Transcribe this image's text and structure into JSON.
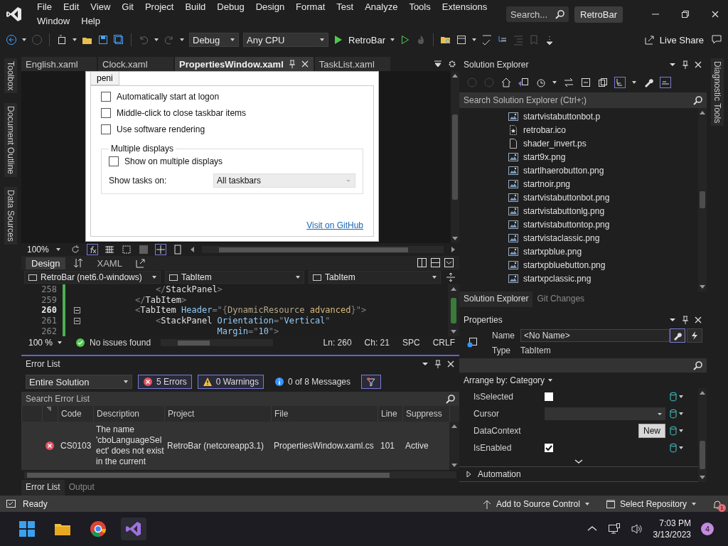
{
  "title_bar": {
    "menu": [
      "File",
      "Edit",
      "View",
      "Git",
      "Project",
      "Build",
      "Debug",
      "Design",
      "Format",
      "Test",
      "Analyze",
      "Tools",
      "Extensions",
      "Window",
      "Help"
    ],
    "search_placeholder": "Search...",
    "solution_name": "RetroBar"
  },
  "toolbar": {
    "configuration": "Debug",
    "platform": "Any CPU",
    "start_target": "RetroBar",
    "live_share": "Live Share"
  },
  "left_tool_tabs": [
    "Toolbox",
    "Document Outline",
    "Data Sources"
  ],
  "right_tool_tabs": [
    "Diagnostic Tools"
  ],
  "document_tabs": [
    {
      "label": "English.xaml",
      "selected": false
    },
    {
      "label": "Clock.xaml",
      "selected": false
    },
    {
      "label": "PropertiesWindow.xaml",
      "selected": true
    },
    {
      "label": "TaskList.xaml",
      "selected": false
    }
  ],
  "designer": {
    "tab_header": "peni",
    "checkboxes": [
      {
        "label": "Automatically start at logon",
        "checked": false
      },
      {
        "label": "Middle-click to close taskbar items",
        "checked": false
      },
      {
        "label": "Use software rendering",
        "checked": false
      }
    ],
    "group": {
      "title": "Multiple displays",
      "checkbox": {
        "label": "Show on multiple displays",
        "checked": false
      },
      "field_label": "Show tasks on:",
      "dropdown_value": "All taskbars"
    },
    "link": "Visit on GitHub"
  },
  "designer_bar": {
    "zoom": "100%"
  },
  "view_tabs": [
    {
      "label": "Design",
      "selected": true
    },
    {
      "label": "XAML",
      "selected": false
    }
  ],
  "nav_bar": [
    "RetroBar (net6.0-windows)",
    "TabItem",
    "TabItem"
  ],
  "code_lines": [
    {
      "number": "258",
      "current": false,
      "foldable": false,
      "tokens": [
        {
          "kind": "punct",
          "text": "    </"
        },
        {
          "kind": "element",
          "text": "StackPanel"
        },
        {
          "kind": "punct",
          "text": ">"
        }
      ]
    },
    {
      "number": "259",
      "current": false,
      "foldable": false,
      "tokens": [
        {
          "kind": "punct",
          "text": "</"
        },
        {
          "kind": "element",
          "text": "TabItem"
        },
        {
          "kind": "punct",
          "text": ">"
        }
      ]
    },
    {
      "number": "260",
      "current": true,
      "foldable": true,
      "tokens": [
        {
          "kind": "punct",
          "text": "<"
        },
        {
          "kind": "element",
          "text": "TabItem"
        },
        {
          "kind": "attribute",
          "text": " Header"
        },
        {
          "kind": "punct",
          "text": "=\"{"
        },
        {
          "kind": "extension",
          "text": "DynamicResource"
        },
        {
          "kind": "argument",
          "text": " advanced"
        },
        {
          "kind": "punct",
          "text": "}\">"
        }
      ]
    },
    {
      "number": "261",
      "current": false,
      "foldable": true,
      "tokens": [
        {
          "kind": "punct",
          "text": "    <"
        },
        {
          "kind": "element",
          "text": "StackPanel"
        },
        {
          "kind": "attribute",
          "text": " Orientation"
        },
        {
          "kind": "punct",
          "text": "=\""
        },
        {
          "kind": "value",
          "text": "Vertical"
        },
        {
          "kind": "punct",
          "text": "\""
        }
      ]
    },
    {
      "number": "262",
      "current": false,
      "foldable": false,
      "tokens": [
        {
          "kind": "attribute",
          "text": "                Margin"
        },
        {
          "kind": "punct",
          "text": "=\""
        },
        {
          "kind": "value",
          "text": "10"
        },
        {
          "kind": "punct",
          "text": "\">"
        }
      ]
    }
  ],
  "editor_status": {
    "zoom": "100 %",
    "issues": "No issues found",
    "line": "Ln: 260",
    "column": "Ch: 21",
    "indent": "SPC",
    "line_ending": "CRLF"
  },
  "error_list": {
    "title": "Error List",
    "scope": "Entire Solution",
    "filters": [
      {
        "kind": "error",
        "label": "5 Errors",
        "selected": true
      },
      {
        "kind": "warning",
        "label": "0 Warnings",
        "selected": true
      },
      {
        "kind": "message",
        "label": "0 of 8 Messages",
        "selected": false
      }
    ],
    "search_placeholder": "Search Error List",
    "columns": [
      "Code",
      "Description",
      "Project",
      "File",
      "Line",
      "Suppress"
    ],
    "rows": [
      {
        "kind": "error",
        "code": "CS0103",
        "description": "The name 'cboLanguageSelect' does not exist in the current",
        "project": "RetroBar (netcoreapp3.1)",
        "file": "PropertiesWindow.xaml.cs",
        "line": "101",
        "suppression": "Active"
      }
    ],
    "tabs": [
      {
        "label": "Error List",
        "selected": true
      },
      {
        "label": "Output",
        "selected": false
      }
    ]
  },
  "solution_explorer": {
    "title": "Solution Explorer",
    "search_placeholder": "Search Solution Explorer (Ctrl+;)",
    "items": [
      {
        "kind": "image",
        "name": "startvistabuttonbot.p"
      },
      {
        "kind": "icon",
        "name": "retrobar.ico"
      },
      {
        "kind": "file",
        "name": "shader_invert.ps"
      },
      {
        "kind": "image",
        "name": "start9x.png"
      },
      {
        "kind": "image",
        "name": "startlhaerobutton.png"
      },
      {
        "kind": "image",
        "name": "startnoir.png"
      },
      {
        "kind": "image",
        "name": "startvistabuttonbot.png"
      },
      {
        "kind": "image",
        "name": "startvistabuttonlg.png"
      },
      {
        "kind": "image",
        "name": "startvistabuttontop.png"
      },
      {
        "kind": "image",
        "name": "startvistaclassic.png"
      },
      {
        "kind": "image",
        "name": "startxpblue.png"
      },
      {
        "kind": "image",
        "name": "startxpbluebutton.png"
      },
      {
        "kind": "image",
        "name": "startxpclassic.png"
      }
    ],
    "tabs": [
      {
        "label": "Solution Explorer",
        "selected": true
      },
      {
        "label": "Git Changes",
        "selected": false
      }
    ]
  },
  "properties": {
    "title": "Properties",
    "name_label": "Name",
    "name_value": "<No Name>",
    "type_label": "Type",
    "type_value": "TabItem",
    "arrange": "Arrange by: Category",
    "rows": [
      {
        "kind": "checkbox",
        "name": "IsSelected",
        "checked": false
      },
      {
        "kind": "dropdown",
        "name": "Cursor"
      },
      {
        "kind": "button",
        "name": "DataContext",
        "button": "New"
      },
      {
        "kind": "checkbox",
        "name": "IsEnabled",
        "checked": true
      }
    ],
    "categories": [
      {
        "name": "Automation",
        "expanded": false
      }
    ]
  },
  "status_bar": {
    "state": "Ready",
    "source_control": "Add to Source Control",
    "repository": "Select Repository",
    "notifications": "1"
  },
  "taskbar": {
    "time": "7:03 PM",
    "date": "3/13/2023",
    "badge": "4"
  }
}
